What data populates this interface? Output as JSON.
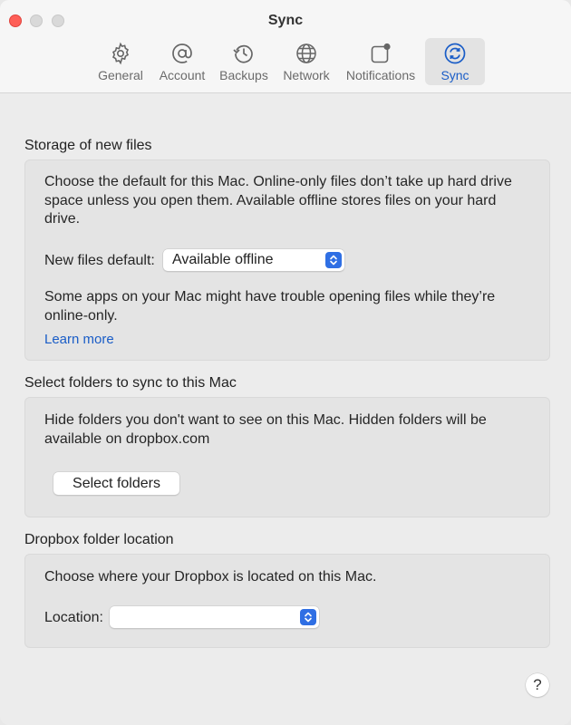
{
  "window": {
    "title": "Sync"
  },
  "toolbar": [
    {
      "label": "General",
      "icon": "gear-icon"
    },
    {
      "label": "Account",
      "icon": "at-icon"
    },
    {
      "label": "Backups",
      "icon": "history-icon"
    },
    {
      "label": "Network",
      "icon": "globe-icon"
    },
    {
      "label": "Notifications",
      "icon": "notification-icon"
    },
    {
      "label": "Sync",
      "icon": "sync-icon",
      "active": true
    }
  ],
  "storage": {
    "title": "Storage of new files",
    "description": "Choose the default for this Mac. Online-only files don’t take up hard drive space unless you open them. Available offline stores files on your hard drive.",
    "default_label": "New files default:",
    "default_value": "Available offline",
    "warning": "Some apps on your Mac might have trouble opening files while they’re online-only.",
    "learn_more": "Learn more"
  },
  "select_folders": {
    "title": "Select folders to sync to this Mac",
    "description": "Hide folders you don't want to see on this Mac. Hidden folders will be available on dropbox.com",
    "button": "Select folders"
  },
  "location": {
    "title": "Dropbox folder location",
    "description": "Choose where your Dropbox is located on this Mac.",
    "label": "Location:",
    "value": ""
  },
  "help": {
    "label": "?"
  },
  "colors": {
    "accent": "#1a5dc7",
    "popup_arrow": "#2f6fe4",
    "close": "#fe5f57"
  }
}
